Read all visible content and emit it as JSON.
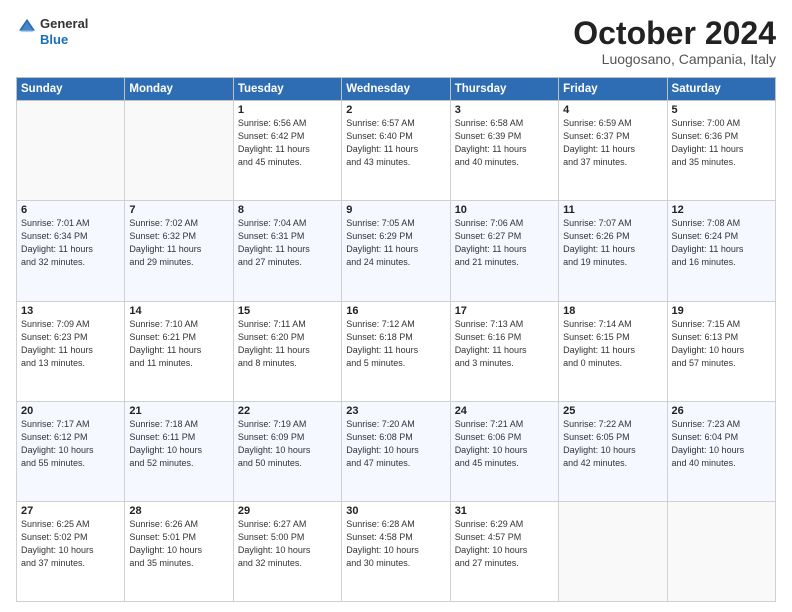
{
  "header": {
    "logo_line1": "General",
    "logo_line2": "Blue",
    "month": "October 2024",
    "location": "Luogosano, Campania, Italy"
  },
  "days_of_week": [
    "Sunday",
    "Monday",
    "Tuesday",
    "Wednesday",
    "Thursday",
    "Friday",
    "Saturday"
  ],
  "weeks": [
    [
      {
        "day": "",
        "info": ""
      },
      {
        "day": "",
        "info": ""
      },
      {
        "day": "1",
        "info": "Sunrise: 6:56 AM\nSunset: 6:42 PM\nDaylight: 11 hours\nand 45 minutes."
      },
      {
        "day": "2",
        "info": "Sunrise: 6:57 AM\nSunset: 6:40 PM\nDaylight: 11 hours\nand 43 minutes."
      },
      {
        "day": "3",
        "info": "Sunrise: 6:58 AM\nSunset: 6:39 PM\nDaylight: 11 hours\nand 40 minutes."
      },
      {
        "day": "4",
        "info": "Sunrise: 6:59 AM\nSunset: 6:37 PM\nDaylight: 11 hours\nand 37 minutes."
      },
      {
        "day": "5",
        "info": "Sunrise: 7:00 AM\nSunset: 6:36 PM\nDaylight: 11 hours\nand 35 minutes."
      }
    ],
    [
      {
        "day": "6",
        "info": "Sunrise: 7:01 AM\nSunset: 6:34 PM\nDaylight: 11 hours\nand 32 minutes."
      },
      {
        "day": "7",
        "info": "Sunrise: 7:02 AM\nSunset: 6:32 PM\nDaylight: 11 hours\nand 29 minutes."
      },
      {
        "day": "8",
        "info": "Sunrise: 7:04 AM\nSunset: 6:31 PM\nDaylight: 11 hours\nand 27 minutes."
      },
      {
        "day": "9",
        "info": "Sunrise: 7:05 AM\nSunset: 6:29 PM\nDaylight: 11 hours\nand 24 minutes."
      },
      {
        "day": "10",
        "info": "Sunrise: 7:06 AM\nSunset: 6:27 PM\nDaylight: 11 hours\nand 21 minutes."
      },
      {
        "day": "11",
        "info": "Sunrise: 7:07 AM\nSunset: 6:26 PM\nDaylight: 11 hours\nand 19 minutes."
      },
      {
        "day": "12",
        "info": "Sunrise: 7:08 AM\nSunset: 6:24 PM\nDaylight: 11 hours\nand 16 minutes."
      }
    ],
    [
      {
        "day": "13",
        "info": "Sunrise: 7:09 AM\nSunset: 6:23 PM\nDaylight: 11 hours\nand 13 minutes."
      },
      {
        "day": "14",
        "info": "Sunrise: 7:10 AM\nSunset: 6:21 PM\nDaylight: 11 hours\nand 11 minutes."
      },
      {
        "day": "15",
        "info": "Sunrise: 7:11 AM\nSunset: 6:20 PM\nDaylight: 11 hours\nand 8 minutes."
      },
      {
        "day": "16",
        "info": "Sunrise: 7:12 AM\nSunset: 6:18 PM\nDaylight: 11 hours\nand 5 minutes."
      },
      {
        "day": "17",
        "info": "Sunrise: 7:13 AM\nSunset: 6:16 PM\nDaylight: 11 hours\nand 3 minutes."
      },
      {
        "day": "18",
        "info": "Sunrise: 7:14 AM\nSunset: 6:15 PM\nDaylight: 11 hours\nand 0 minutes."
      },
      {
        "day": "19",
        "info": "Sunrise: 7:15 AM\nSunset: 6:13 PM\nDaylight: 10 hours\nand 57 minutes."
      }
    ],
    [
      {
        "day": "20",
        "info": "Sunrise: 7:17 AM\nSunset: 6:12 PM\nDaylight: 10 hours\nand 55 minutes."
      },
      {
        "day": "21",
        "info": "Sunrise: 7:18 AM\nSunset: 6:11 PM\nDaylight: 10 hours\nand 52 minutes."
      },
      {
        "day": "22",
        "info": "Sunrise: 7:19 AM\nSunset: 6:09 PM\nDaylight: 10 hours\nand 50 minutes."
      },
      {
        "day": "23",
        "info": "Sunrise: 7:20 AM\nSunset: 6:08 PM\nDaylight: 10 hours\nand 47 minutes."
      },
      {
        "day": "24",
        "info": "Sunrise: 7:21 AM\nSunset: 6:06 PM\nDaylight: 10 hours\nand 45 minutes."
      },
      {
        "day": "25",
        "info": "Sunrise: 7:22 AM\nSunset: 6:05 PM\nDaylight: 10 hours\nand 42 minutes."
      },
      {
        "day": "26",
        "info": "Sunrise: 7:23 AM\nSunset: 6:04 PM\nDaylight: 10 hours\nand 40 minutes."
      }
    ],
    [
      {
        "day": "27",
        "info": "Sunrise: 6:25 AM\nSunset: 5:02 PM\nDaylight: 10 hours\nand 37 minutes."
      },
      {
        "day": "28",
        "info": "Sunrise: 6:26 AM\nSunset: 5:01 PM\nDaylight: 10 hours\nand 35 minutes."
      },
      {
        "day": "29",
        "info": "Sunrise: 6:27 AM\nSunset: 5:00 PM\nDaylight: 10 hours\nand 32 minutes."
      },
      {
        "day": "30",
        "info": "Sunrise: 6:28 AM\nSunset: 4:58 PM\nDaylight: 10 hours\nand 30 minutes."
      },
      {
        "day": "31",
        "info": "Sunrise: 6:29 AM\nSunset: 4:57 PM\nDaylight: 10 hours\nand 27 minutes."
      },
      {
        "day": "",
        "info": ""
      },
      {
        "day": "",
        "info": ""
      }
    ]
  ]
}
